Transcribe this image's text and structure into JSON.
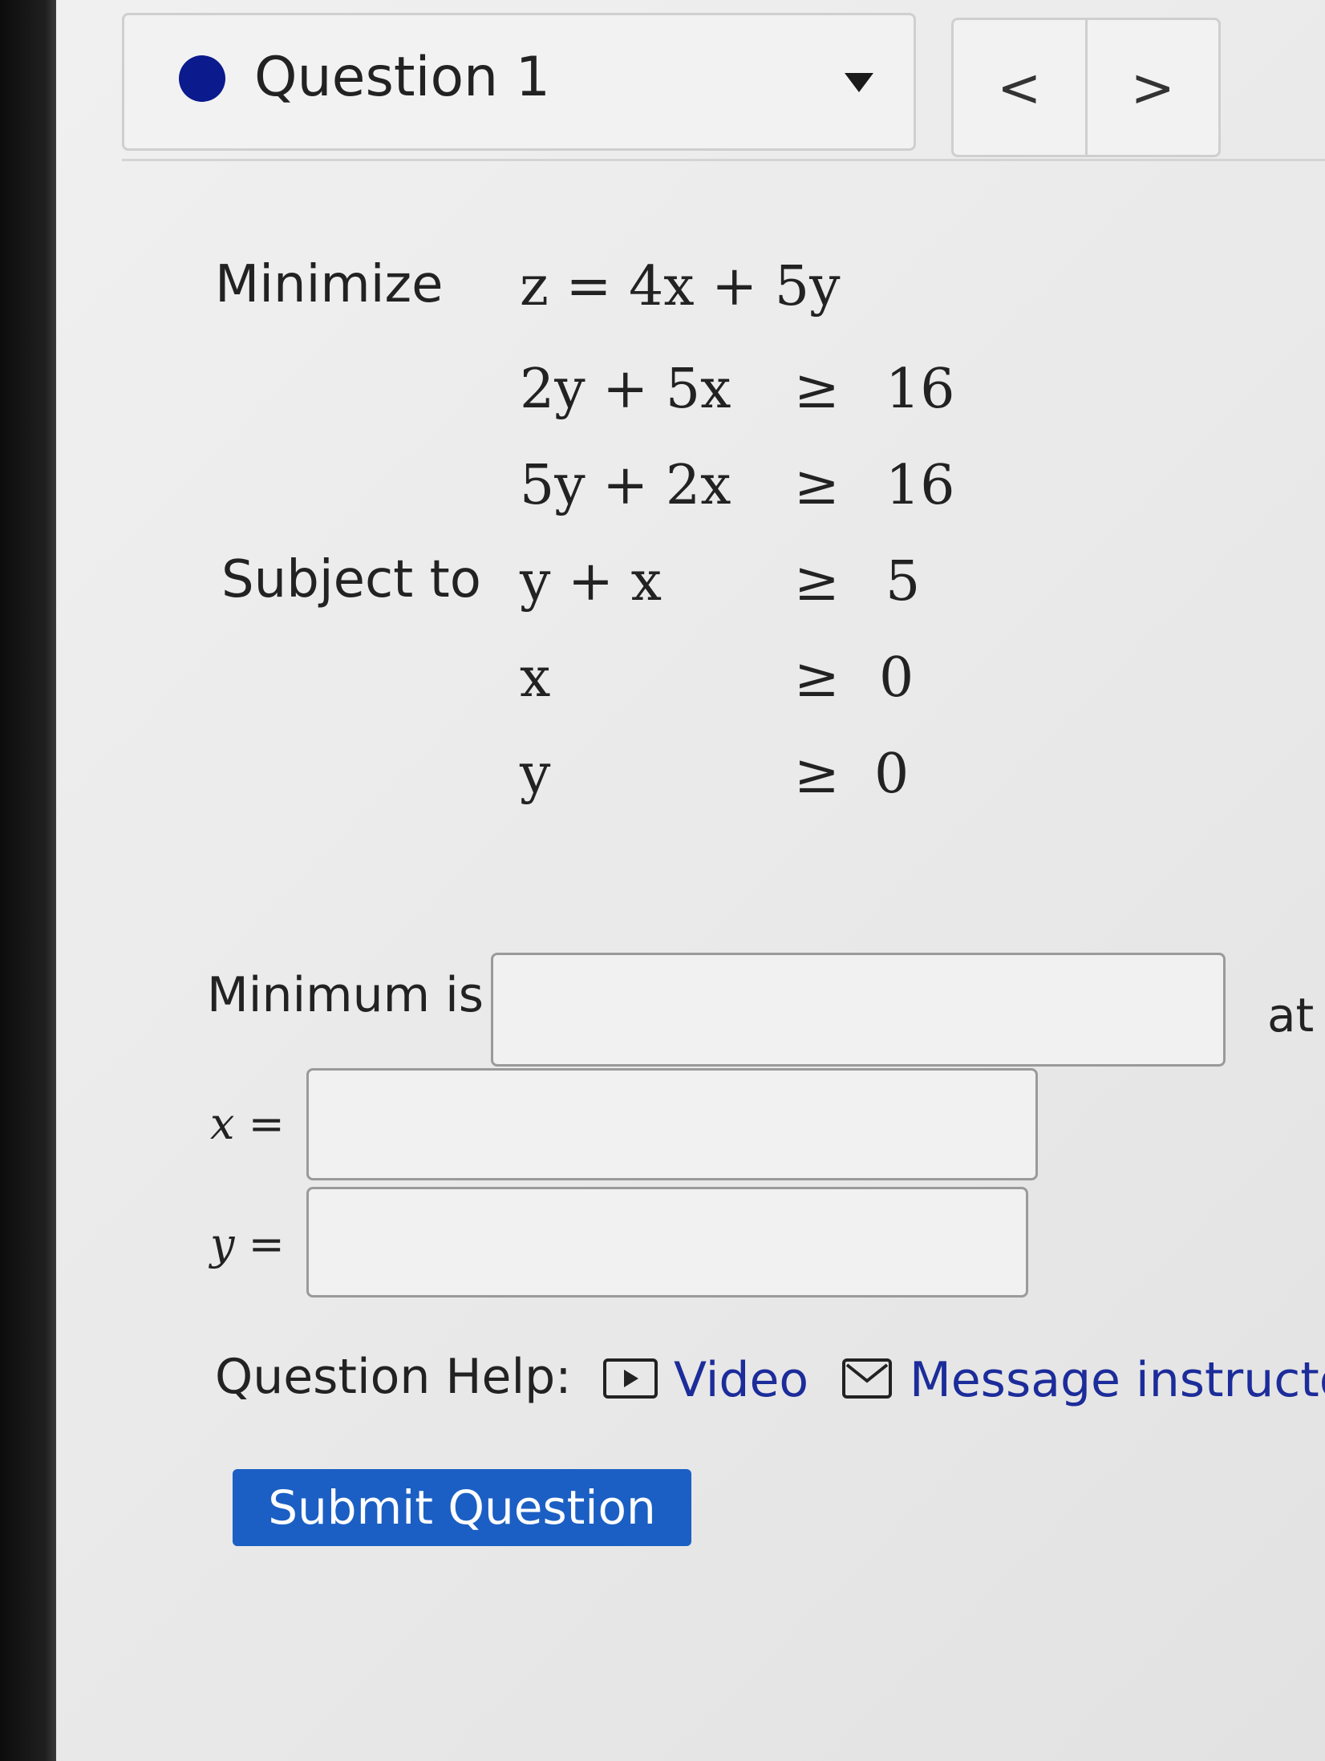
{
  "header": {
    "question_title": "Question 1",
    "prev_label": "<",
    "next_label": ">",
    "status_color": "#0b1a8c"
  },
  "problem": {
    "minimize_label": "Minimize",
    "subject_to_label": "Subject to",
    "objective": "z = 4x + 5y",
    "constraints": [
      {
        "lhs": "2y + 5x",
        "rel": "≥",
        "rhs": "16"
      },
      {
        "lhs": "5y + 2x",
        "rel": "≥",
        "rhs": "16"
      },
      {
        "lhs": "y + x",
        "rel": "≥",
        "rhs": "5"
      },
      {
        "lhs": "x",
        "rel": "≥",
        "rhs": "0"
      },
      {
        "lhs": "y",
        "rel": "≥",
        "rhs": "0"
      }
    ]
  },
  "answer": {
    "minimum_label": "Minimum is",
    "at_label": "at",
    "x_label": "x =",
    "y_label": "y =",
    "minimum_value": "",
    "x_value": "",
    "y_value": ""
  },
  "help": {
    "label": "Question Help:",
    "video_label": "Video",
    "message_label": "Message instructor",
    "link_color": "#1c2c9a"
  },
  "submit": {
    "label": "Submit Question",
    "color": "#1b5fc4"
  }
}
